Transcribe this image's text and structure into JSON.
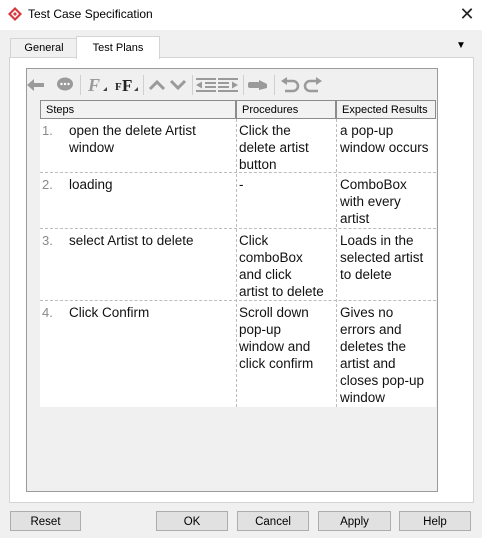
{
  "window": {
    "title": "Test Case Specification",
    "close_glyph": "✕"
  },
  "tabs": [
    {
      "label": "General",
      "active": false
    },
    {
      "label": "Test Plans",
      "active": true
    }
  ],
  "tab_menu_glyph": "▼",
  "toolbar": {
    "icons": [
      "arrow-left-icon",
      "comment-icon",
      "italic-font-icon",
      "bold-font-icon",
      "move-up-icon",
      "move-down-icon",
      "outdent-icon",
      "indent-icon",
      "link-icon",
      "undo-icon",
      "redo-icon"
    ]
  },
  "table": {
    "columns": [
      "Steps",
      "Procedures",
      "Expected Results"
    ],
    "rows": [
      {
        "num": "1.",
        "step": [
          "open the delete Artist",
          "window"
        ],
        "procedure": [
          "Click the",
          "delete artist",
          "button"
        ],
        "expected": [
          "a pop-up",
          "window occurs"
        ]
      },
      {
        "num": "2.",
        "step": [
          "loading"
        ],
        "procedure": [
          "-"
        ],
        "expected": [
          "ComboBox",
          "with every",
          "artist"
        ]
      },
      {
        "num": "3.",
        "step": [
          "select Artist to delete"
        ],
        "procedure": [
          "Click",
          "comboBox",
          "and click",
          "artist to delete"
        ],
        "expected": [
          "Loads in the",
          "selected artist",
          "to delete"
        ]
      },
      {
        "num": "4.",
        "step": [
          "Click Confirm"
        ],
        "procedure": [
          "Scroll down",
          "pop-up",
          "window and",
          "click confirm"
        ],
        "expected": [
          "Gives no",
          "errors and",
          "deletes the",
          "artist and",
          "closes pop-up",
          "window"
        ]
      }
    ]
  },
  "buttons": {
    "reset": "Reset",
    "ok": "OK",
    "cancel": "Cancel",
    "apply": "Apply",
    "help": "Help"
  },
  "colors": {
    "app_icon": "#d9363e",
    "toolbar_icon": "#9a9a9a"
  }
}
